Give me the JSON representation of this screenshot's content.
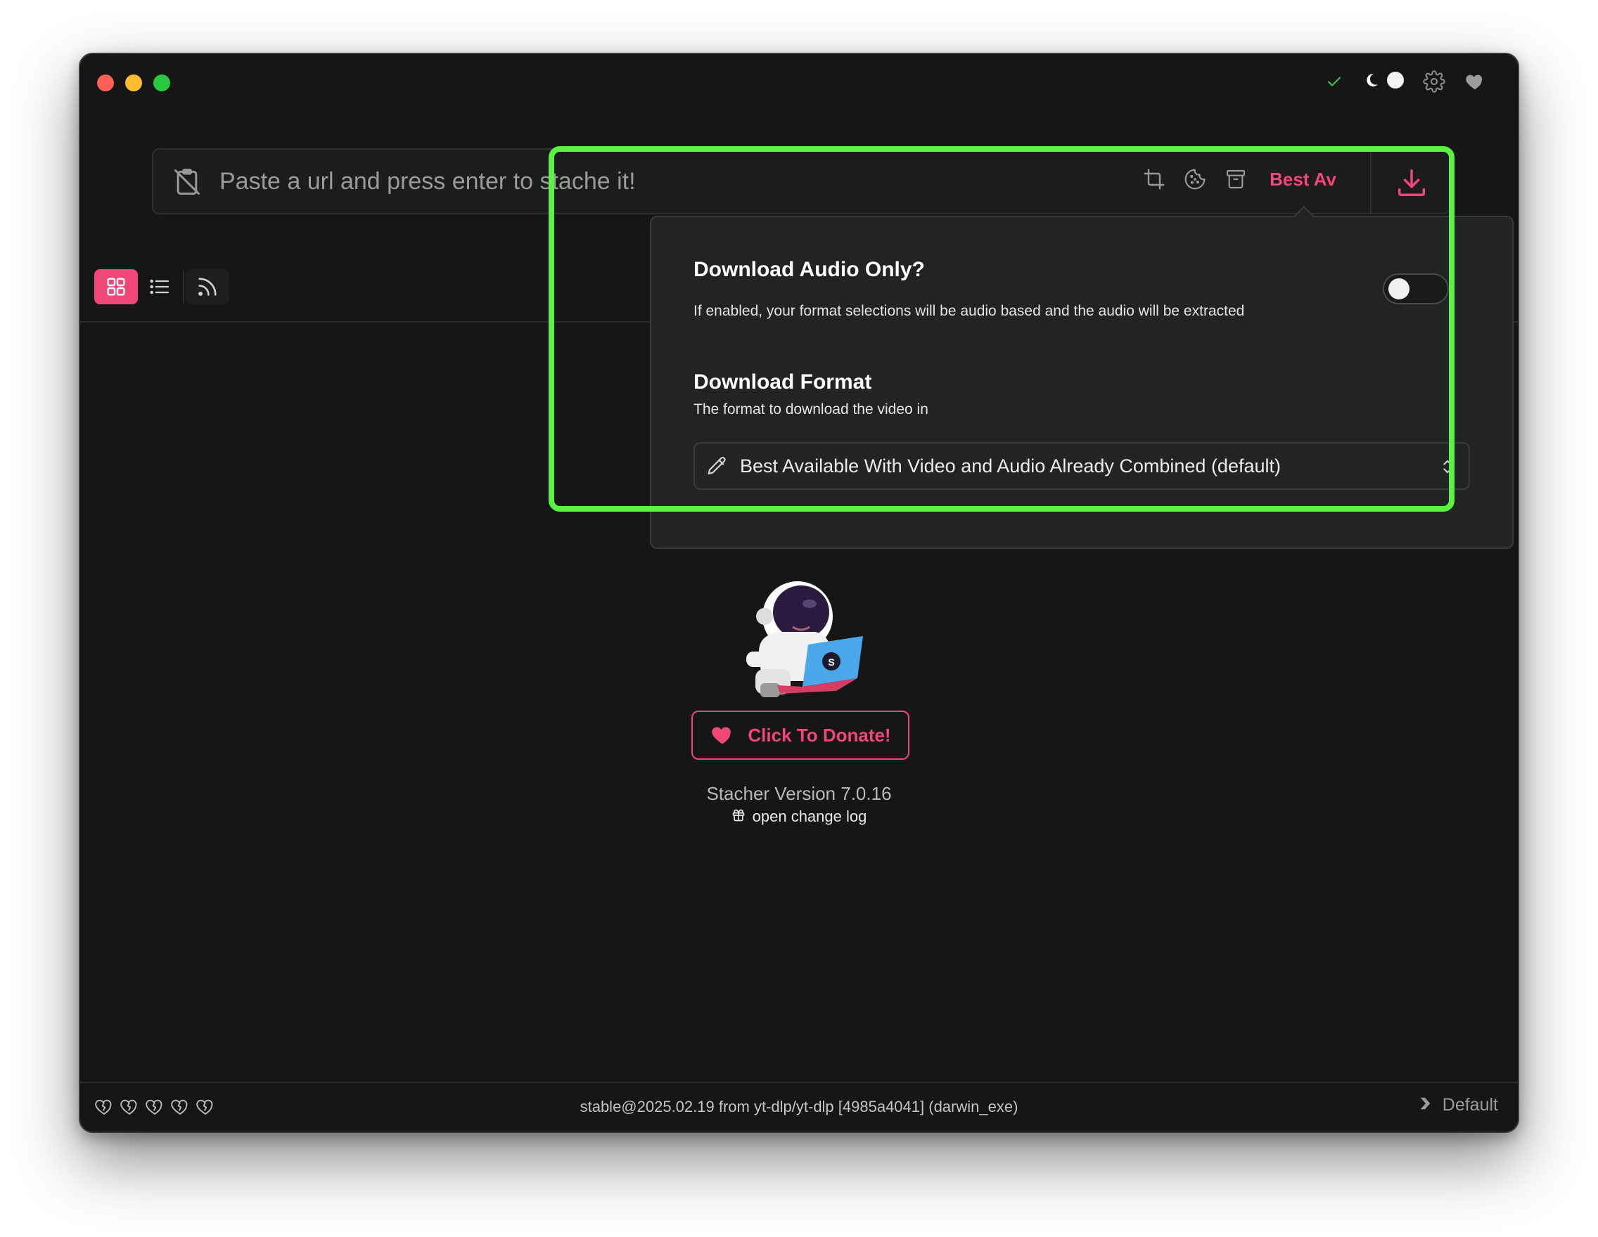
{
  "url_bar": {
    "placeholder": "Paste a url and press enter to stache it!",
    "format_short": "Best Av"
  },
  "popover": {
    "audio_only_title": "Download Audio Only?",
    "audio_only_desc": "If enabled, your format selections will be audio based and the audio will be extracted",
    "audio_only_enabled": false,
    "format_title": "Download Format",
    "format_desc": "The format to download the video in",
    "format_value": "Best Available With Video and Audio Already Combined (default)"
  },
  "main": {
    "donate_label": "Click To Donate!",
    "version_text": "Stacher Version 7.0.16",
    "changelog_label": "open change log"
  },
  "footer": {
    "ytdlp_status": "stable@2025.02.19 from yt-dlp/yt-dlp [4985a4041] (darwin_exe)",
    "profile_label": "Default",
    "heart_count": 5
  },
  "colors": {
    "accent": "#ef4777",
    "highlight": "#5df143",
    "background": "#161616"
  },
  "icons": [
    "check-icon",
    "moon-icon",
    "gear-icon",
    "heart-icon",
    "clipboard-off-icon",
    "crop-icon",
    "cookie-icon",
    "archive-icon",
    "download-icon",
    "grid-icon",
    "list-icon",
    "rss-icon",
    "pencil-icon",
    "chevron-up-down-icon",
    "gift-icon",
    "broken-heart-icon",
    "chevron-right-icon"
  ]
}
